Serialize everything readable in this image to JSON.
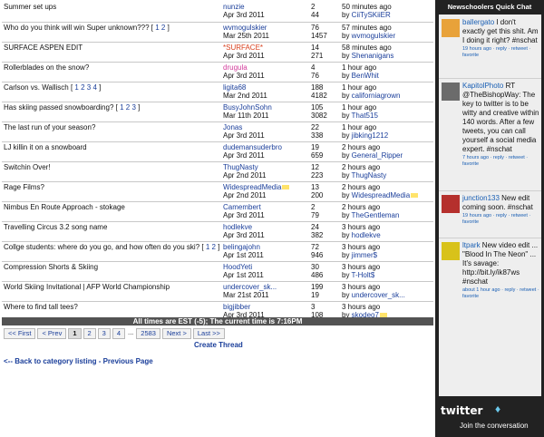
{
  "threads": [
    {
      "title": "Summer set ups",
      "pages": [],
      "author": "nunzie",
      "author_style": "blue",
      "date": "Apr 3rd 2011",
      "replies": "2",
      "views": "44",
      "last_time": "50 minutes ago",
      "last_by": "CiiTySKiiER"
    },
    {
      "title": "Who do you think will win Super unknown???",
      "pages": [
        "1",
        "2"
      ],
      "author": "wvmogulskier",
      "author_style": "blue",
      "date": "Mar 25th 2011",
      "replies": "76",
      "views": "1457",
      "last_time": "57 minutes ago",
      "last_by": "wvmogulskier"
    },
    {
      "title": "SURFACE ASPEN EDIT",
      "pages": [],
      "author": "*SURFACE*",
      "author_style": "red",
      "date": "Apr 3rd 2011",
      "replies": "14",
      "views": "271",
      "last_time": "58 minutes ago",
      "last_by": "Shenanigans"
    },
    {
      "title": "Rollerblades on the snow?",
      "pages": [],
      "author": "drugula",
      "author_style": "pink",
      "date": "Apr 3rd 2011",
      "replies": "4",
      "views": "76",
      "last_time": "1 hour ago",
      "last_by": "BenWhit"
    },
    {
      "title": "Carlson vs. Wallisch",
      "pages": [
        "1",
        "2",
        "3",
        "4"
      ],
      "author": "ligita68",
      "author_style": "blue",
      "date": "Mar 2nd 2011",
      "replies": "188",
      "views": "4182",
      "last_time": "1 hour ago",
      "last_by": "californiagrown"
    },
    {
      "title": "Has skiing passed snowboarding?",
      "pages": [
        "1",
        "2",
        "3"
      ],
      "author": "BusyJohnSohn",
      "author_style": "blue",
      "date": "Mar 11th 2011",
      "replies": "105",
      "views": "3082",
      "last_time": "1 hour ago",
      "last_by": "That515"
    },
    {
      "title": "The last run of your season?",
      "pages": [],
      "author": "Jonas",
      "author_style": "blue",
      "date": "Apr 3rd 2011",
      "replies": "22",
      "views": "338",
      "last_time": "1 hour ago",
      "last_by": "jibking1212"
    },
    {
      "title": "LJ killin it on a snowboard",
      "pages": [],
      "author": "dudemansuderbro",
      "author_style": "blue",
      "date": "Apr 3rd 2011",
      "replies": "19",
      "views": "659",
      "last_time": "2 hours ago",
      "last_by": "General_Ripper"
    },
    {
      "title": "Switchin Over!",
      "pages": [],
      "author": "ThugNasty",
      "author_style": "blue",
      "date": "Apr 2nd 2011",
      "replies": "12",
      "views": "223",
      "last_time": "2 hours ago",
      "last_by": "ThugNasty"
    },
    {
      "title": "Rage Films?",
      "pages": [],
      "author": "WidespreadMedia",
      "author_style": "blue",
      "author_icon": true,
      "date": "Apr 2nd 2011",
      "replies": "13",
      "views": "200",
      "last_time": "2 hours ago",
      "last_by": "WidespreadMedia",
      "last_icon": true
    },
    {
      "title": "Nimbus En Route Approach - stokage",
      "pages": [],
      "author": "Camembert",
      "author_style": "blue",
      "date": "Apr 3rd 2011",
      "replies": "2",
      "views": "79",
      "last_time": "2 hours ago",
      "last_by": "TheGentleman"
    },
    {
      "title": "Travelling Circus 3.2 song name",
      "pages": [],
      "author": "hodlekve",
      "author_style": "blue",
      "date": "Apr 3rd 2011",
      "replies": "24",
      "views": "382",
      "last_time": "3 hours ago",
      "last_by": "hodlekve"
    },
    {
      "title": "Collge students: where do you go, and how often do you ski?",
      "pages": [
        "1",
        "2"
      ],
      "author": "belingajohn",
      "author_style": "blue",
      "date": "Apr 1st 2011",
      "replies": "72",
      "views": "946",
      "last_time": "3 hours ago",
      "last_by": "jimmer$"
    },
    {
      "title": "Compression Shorts & Skiing",
      "pages": [],
      "author": "HoodYeti",
      "author_style": "blue",
      "date": "Apr 1st 2011",
      "replies": "30",
      "views": "486",
      "last_time": "3 hours ago",
      "last_by": "T-Holt$"
    },
    {
      "title": "World Skiing Invitational | AFP World Championship",
      "pages": [],
      "author": "undercover_sk...",
      "author_style": "blue",
      "date": "Mar 21st 2011",
      "replies": "199",
      "views": "19",
      "last_time": "3 hours ago",
      "last_by": "undercover_sk..."
    },
    {
      "title": "Where to find tall tees?",
      "pages": [],
      "author": "bigjibber",
      "author_style": "blue",
      "date": "Apr 3rd 2011",
      "replies": "3",
      "views": "108",
      "last_time": "3 hours ago",
      "last_by": "skodeo7",
      "last_icon": true
    }
  ],
  "by_prefix": "by ",
  "time_bar": "All times are EST (-5); The current time is 7:16PM",
  "pager": {
    "first": "<< First",
    "prev": "< Prev",
    "pages": [
      "1",
      "2",
      "3",
      "4"
    ],
    "current": "1",
    "ellipsis": "...",
    "last_page": "2583",
    "next": "Next >",
    "last": "Last >>"
  },
  "create_thread": "Create Thread",
  "back_links": {
    "back": "<-- Back to category listing",
    "sep": " - ",
    "prev": "Previous Page"
  },
  "sidebar": {
    "title": "Newschoolers Quick Chat",
    "tweets": [
      {
        "user": "ballergato",
        "text": " I don't exactly get this shit. Am I doing it right? #nschat",
        "meta": "19 hours ago · reply · retweet · favorite",
        "avatar_color": "#e8a23a"
      },
      {
        "user": "KapitolPhoto",
        "text": " RT @TheBishopWay: The key to twitter is to be witty and creative within 140 words. After a few tweets, you can call yourself a social media expert. #nschat",
        "meta": "7 hours ago · reply · retweet · favorite",
        "avatar_color": "#6b6b6b"
      },
      {
        "user": "junction133",
        "text": " New edit coming soon. #nschat",
        "meta": "19 hours ago · reply · retweet · favorite",
        "avatar_color": "#b5302d"
      },
      {
        "user": "ltpark",
        "text": " New video edit ... \"Blood In The Neon\" ... It's savage: http://bit.ly/ik87ws #nschat",
        "meta": "about 1 hour ago · reply · retweet · favorite",
        "avatar_color": "#d8c21a"
      }
    ],
    "logo": "twitter",
    "join": "Join the conversation"
  }
}
